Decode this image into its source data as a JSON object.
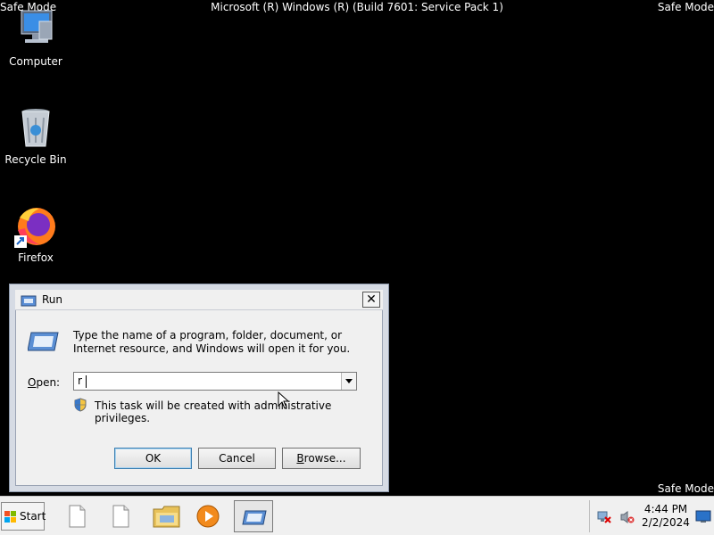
{
  "screen": {
    "corner_label": "Safe Mode",
    "title": "Microsoft (R) Windows (R) (Build 7601: Service Pack 1)"
  },
  "desktop_icons": [
    {
      "label": "Computer",
      "icon": "computer-icon"
    },
    {
      "label": "Recycle Bin",
      "icon": "recycle-bin-icon"
    },
    {
      "label": "Firefox",
      "icon": "firefox-icon"
    }
  ],
  "run_dialog": {
    "title": "Run",
    "close_symbol": "✕",
    "description": "Type the name of a program, folder, document, or Internet resource, and Windows will open it for you.",
    "open_label_accel": "O",
    "open_label_rest": "pen:",
    "input_value": "r",
    "admin_note": "This task will be created with administrative privileges.",
    "buttons": {
      "ok": "OK",
      "cancel": "Cancel",
      "browse_accel": "B",
      "browse_rest": "rowse..."
    }
  },
  "taskbar": {
    "start_label": "Start",
    "items": [
      {
        "icon": "document-icon"
      },
      {
        "icon": "document-icon"
      },
      {
        "icon": "file-explorer-icon"
      },
      {
        "icon": "media-player-icon"
      },
      {
        "icon": "run-dialog-icon",
        "active": true
      }
    ],
    "tray_icons": [
      "network-disconnected-icon",
      "volume-muted-icon",
      "show-desktop-icon"
    ],
    "time": "4:44 PM",
    "date": "2/2/2024"
  },
  "colors": {
    "desktop_background": "#000000",
    "taskbar": "#f0f0f0",
    "dialog_face": "#f0f0f0"
  }
}
